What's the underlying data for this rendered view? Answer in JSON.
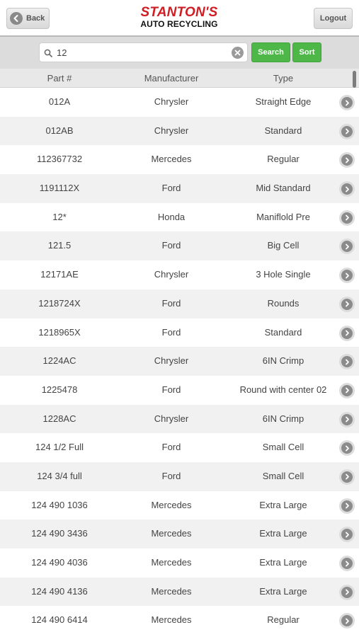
{
  "header": {
    "back_label": "Back",
    "logout_label": "Logout",
    "logo_brand": "STANTON'S",
    "logo_sub": "AUTO RECYCLING"
  },
  "search": {
    "value": "12",
    "search_label": "Search",
    "sort_label": "Sort"
  },
  "table": {
    "columns": [
      "Part #",
      "Manufacturer",
      "Type"
    ],
    "rows": [
      {
        "part": "012A",
        "manufacturer": "Chrysler",
        "type": "Straight Edge"
      },
      {
        "part": "012AB",
        "manufacturer": "Chrysler",
        "type": "Standard"
      },
      {
        "part": "112367732",
        "manufacturer": "Mercedes",
        "type": "Regular"
      },
      {
        "part": "1191112X",
        "manufacturer": "Ford",
        "type": "Mid Standard"
      },
      {
        "part": "12*",
        "manufacturer": "Honda",
        "type": "Maniflold Pre"
      },
      {
        "part": "121.5",
        "manufacturer": "Ford",
        "type": "Big Cell"
      },
      {
        "part": "12171AE",
        "manufacturer": "Chrysler",
        "type": "3 Hole Single"
      },
      {
        "part": "1218724X",
        "manufacturer": "Ford",
        "type": "Rounds"
      },
      {
        "part": "1218965X",
        "manufacturer": "Ford",
        "type": "Standard"
      },
      {
        "part": "1224AC",
        "manufacturer": "Chrysler",
        "type": "6IN Crimp"
      },
      {
        "part": "1225478",
        "manufacturer": "Ford",
        "type": "Round with center 02"
      },
      {
        "part": "1228AC",
        "manufacturer": "Chrysler",
        "type": "6IN Crimp"
      },
      {
        "part": "124 1/2 Full",
        "manufacturer": "Ford",
        "type": "Small Cell"
      },
      {
        "part": "124 3/4 full",
        "manufacturer": "Ford",
        "type": "Small Cell"
      },
      {
        "part": "124 490 1036",
        "manufacturer": "Mercedes",
        "type": "Extra Large"
      },
      {
        "part": "124 490 3436",
        "manufacturer": "Mercedes",
        "type": "Extra Large"
      },
      {
        "part": "124 490 4036",
        "manufacturer": "Mercedes",
        "type": "Extra Large"
      },
      {
        "part": "124 490 4136",
        "manufacturer": "Mercedes",
        "type": "Extra Large"
      },
      {
        "part": "124 490 6414",
        "manufacturer": "Mercedes",
        "type": "Regular"
      }
    ]
  },
  "icons": {
    "back": "arrow-left-circle-icon",
    "search": "magnifier-icon",
    "clear": "clear-x-circle-icon",
    "row_action": "chevron-right-circle-icon"
  },
  "colors": {
    "brand_red": "#d01e24",
    "accent_green": "#4db848",
    "row_alt": "#f1f1f1"
  }
}
